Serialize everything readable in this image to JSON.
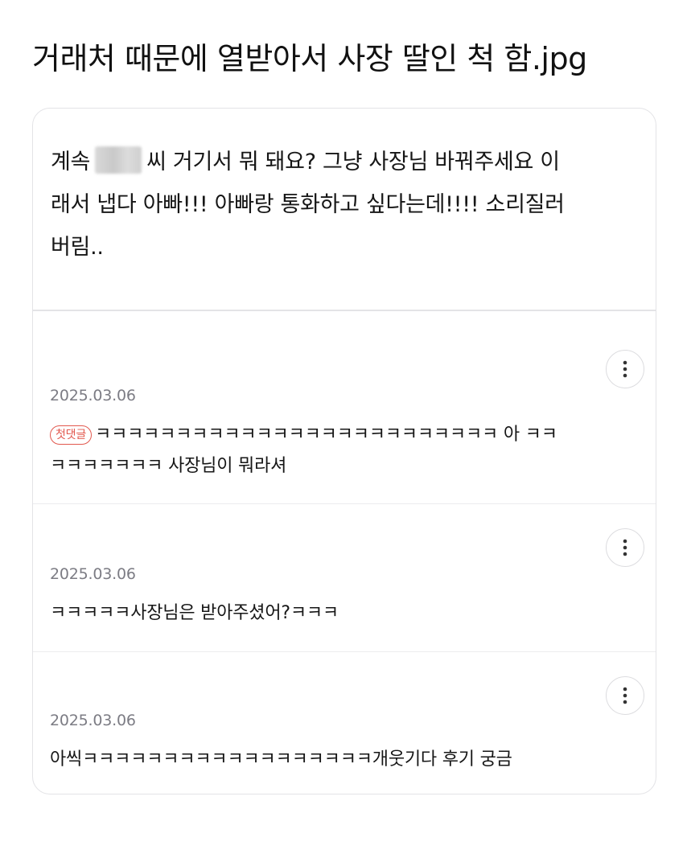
{
  "page": {
    "title": "거래처 때문에 열받아서 사장 딸인 척 함.jpg"
  },
  "post": {
    "line1_before": "계속",
    "line1_after": "씨 거기서 뭐 돼요? 그냥 사장님 바꿔주세요 이",
    "line2": "래서 냅다 아빠!!! 아빠랑 통화하고 싶다는데!!!! 소리질러",
    "line3": "버림.."
  },
  "comments": [
    {
      "date": "2025.03.06",
      "badge": "첫댓글",
      "line1": "ㅋㅋㅋㅋㅋㅋㅋㅋㅋㅋㅋㅋㅋㅋㅋㅋㅋㅋㅋㅋㅋㅋㅋㅋㅋ 아 ㅋㅋ",
      "line2": "ㅋㅋㅋㅋㅋㅋㅋ 사장님이 뭐라셔"
    },
    {
      "date": "2025.03.06",
      "line1": "ㅋㅋㅋㅋㅋ사장님은 받아주셨어?ㅋㅋㅋ"
    },
    {
      "date": "2025.03.06",
      "line1": "아씩ㅋㅋㅋㅋㅋㅋㅋㅋㅋㅋㅋㅋㅋㅋㅋㅋㅋㅋ개웃기다 후기 궁금"
    }
  ],
  "icons": {
    "more": "more-vertical-icon",
    "redaction": "blurred-name"
  },
  "colors": {
    "badge": "#e2584e",
    "date": "#7c7c84",
    "border": "#e3e3e6"
  }
}
